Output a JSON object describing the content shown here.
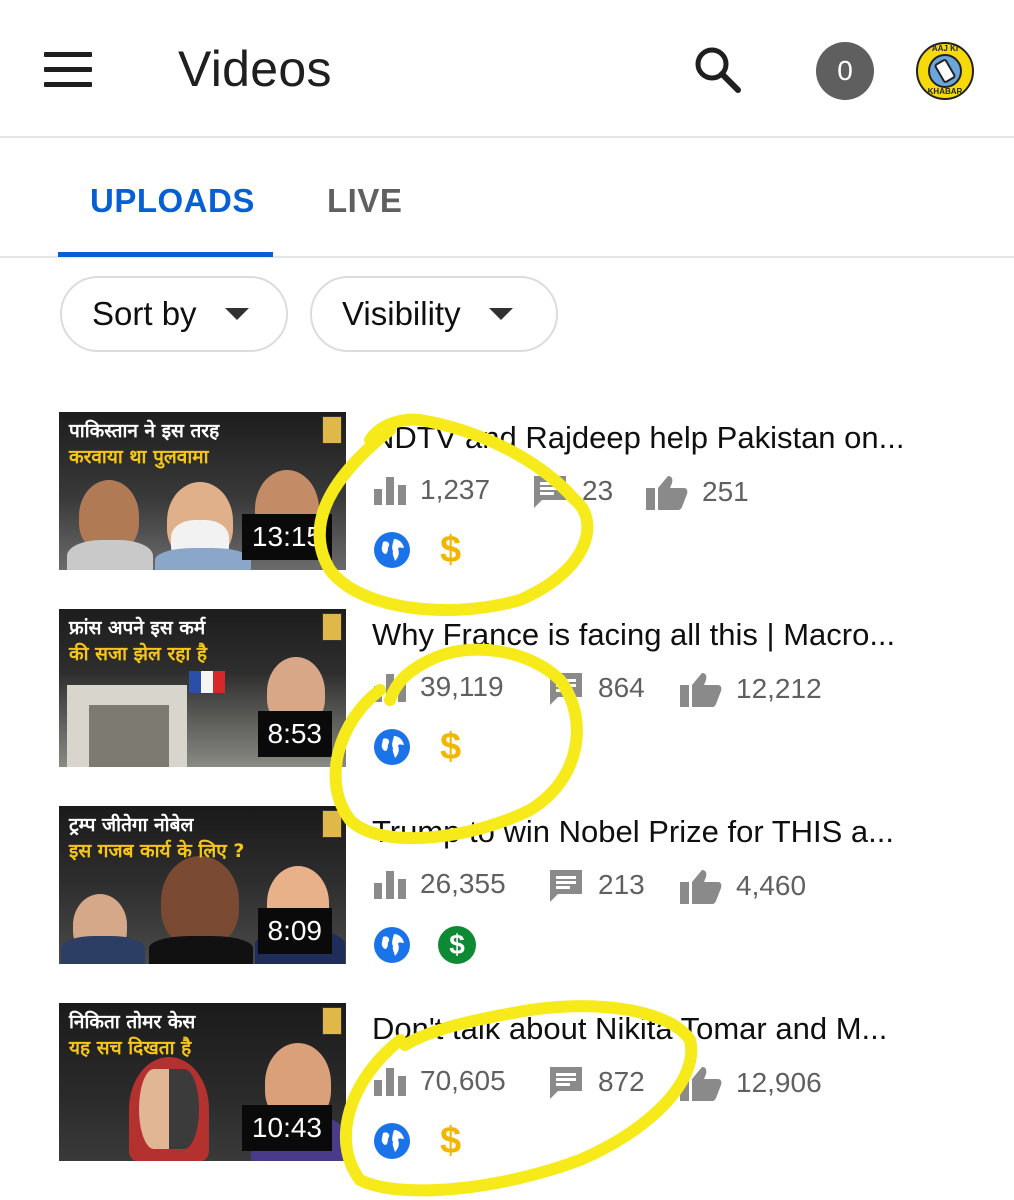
{
  "appbar": {
    "title": "Videos",
    "notification_count": "0",
    "avatar_text_top": "AAJ KI",
    "avatar_text_bottom": "KHABAR"
  },
  "tabs": [
    {
      "label": "UPLOADS",
      "selected": true
    },
    {
      "label": "LIVE",
      "selected": false
    }
  ],
  "filters": {
    "sort_label": "Sort by",
    "visibility_label": "Visibility"
  },
  "videos": [
    {
      "title": "NDTV and Rajdeep help Pakistan on...",
      "thumb_line1": "पाकिस्तान ने इस तरह",
      "thumb_line2": "करवाया था पुलवामा",
      "duration": "13:15",
      "views": "1,237",
      "comments": "23",
      "likes": "251",
      "visibility_icon": "globe-icon",
      "monetization": "limited"
    },
    {
      "title": "Why France is facing all this | Macro...",
      "thumb_line1": "फ्रांस अपने इस कर्म",
      "thumb_line2": "की सजा झेल रहा है",
      "duration": "8:53",
      "views": "39,119",
      "comments": "864",
      "likes": "12,212",
      "visibility_icon": "globe-icon",
      "monetization": "limited"
    },
    {
      "title": "Trump to win Nobel Prize for THIS a...",
      "thumb_line1": "ट्रम्प जीतेगा नोबेल",
      "thumb_line2": "इस गजब कार्य के लिए ?",
      "duration": "8:09",
      "views": "26,355",
      "comments": "213",
      "likes": "4,460",
      "visibility_icon": "globe-icon",
      "monetization": "on"
    },
    {
      "title": "Don't talk about Nikita Tomar and M...",
      "thumb_line1": "निकिता तोमर केस",
      "thumb_line2": "यह सच दिखता है",
      "duration": "10:43",
      "views": "70,605",
      "comments": "872",
      "likes": "12,906",
      "visibility_icon": "globe-icon",
      "monetization": "limited"
    }
  ],
  "colors": {
    "accent_blue": "#065fd4",
    "limited_dollar": "#f2b600",
    "monetized_green": "#0f8a34",
    "highlight_yellow": "#f7ea1b"
  }
}
